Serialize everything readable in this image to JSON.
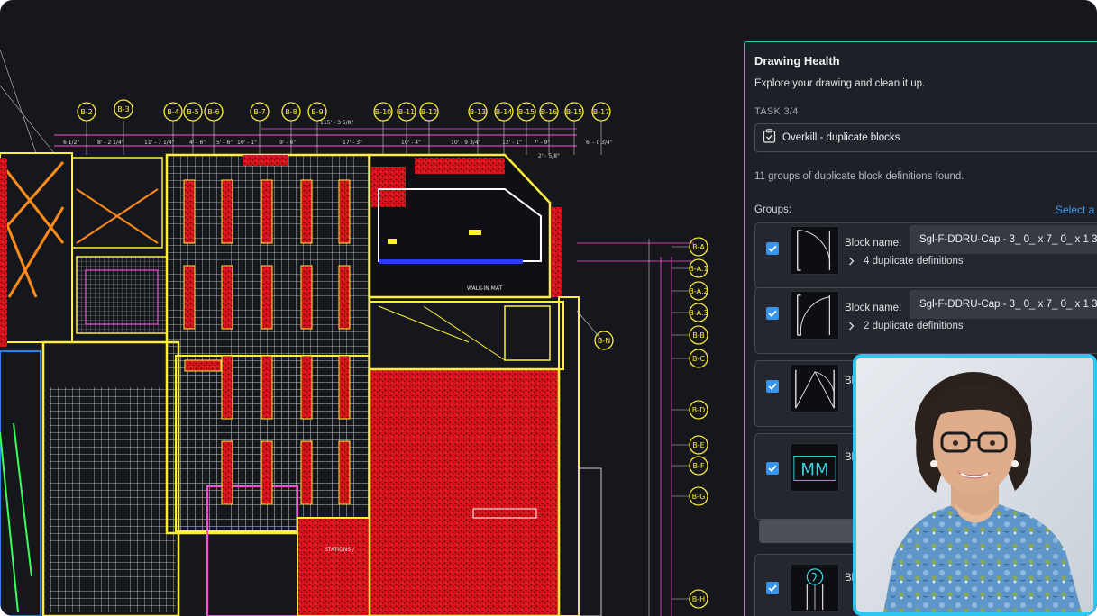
{
  "panel": {
    "title": "Drawing Health",
    "subtitle": "Explore your drawing and clean it up.",
    "task_label": "TASK 3/4",
    "task_name": "Overkill - duplicate blocks",
    "found_text": "11 groups of duplicate block definitions found.",
    "groups_label": "Groups:",
    "select_all": "Select a",
    "block_label": "Block name:",
    "groups": [
      {
        "block_name": "Sgl-F-DDRU-Cap - 3_ 0_ x 7_ 0_ x 1 3_4",
        "duplicates": "4 duplicate definitions",
        "checked": true,
        "thumb_icon": "door-swing-icon"
      },
      {
        "block_name": "Sgl-F-DDRU-Cap - 3_ 0_ x 7_ 0_ x 1 3_4",
        "duplicates": "2 duplicate definitions",
        "checked": true,
        "thumb_icon": "door-swing-icon"
      },
      {
        "block_name": "Bl",
        "checked": true,
        "thumb_icon": "double-door-icon"
      },
      {
        "block_name": "Bl",
        "checked": true,
        "thumb_icon": "mm-symbol-icon",
        "thumb_text": "MM"
      },
      {
        "block_name": "Bl",
        "checked": true,
        "thumb_icon": "fixture-symbol-icon"
      }
    ]
  },
  "cad": {
    "top_grid_labels": [
      "B-2",
      "B-3",
      "B-4",
      "B-5",
      "B-6",
      "B-7",
      "B-8",
      "B-9",
      "B-10",
      "B-11",
      "B-12",
      "B-13",
      "B-14",
      "B-15",
      "B-16",
      "B-15",
      "B-17"
    ],
    "right_grid_labels": [
      "B-A",
      "B-A.1",
      "B-A.2",
      "B-A.3",
      "B-B",
      "B-C",
      "B-D",
      "B-E",
      "B-F",
      "B-G",
      "B-H"
    ],
    "mid_label": "B-N",
    "room_text_1": "WALK-IN MAT",
    "room_text_2": "STATIONS /",
    "dimension_texts": [
      "6 1/2\"",
      "8' - 2 1/4\"",
      "11' - 7 1/4\"",
      "4' - 6\"",
      "5' - 6\"",
      "10' - 1\"",
      "9' - 6\"",
      "17' - 3\"",
      "115' - 3 5/8\"",
      "10' - 4\"",
      "10' - 9 3/4\"",
      "12' - 1\"",
      "7' - 9\"",
      "6' - 0 3/4\"",
      "2' - 5/8\""
    ]
  },
  "colors": {
    "panel_accent": "#35c4b8",
    "checkbox": "#3794ec",
    "select_all_link": "#3d9bf0",
    "presenter_border": "#2ec6f0",
    "cad_yellow": "#ffef3a",
    "cad_red": "#e3141b",
    "cad_magenta": "#ff4fd8"
  }
}
